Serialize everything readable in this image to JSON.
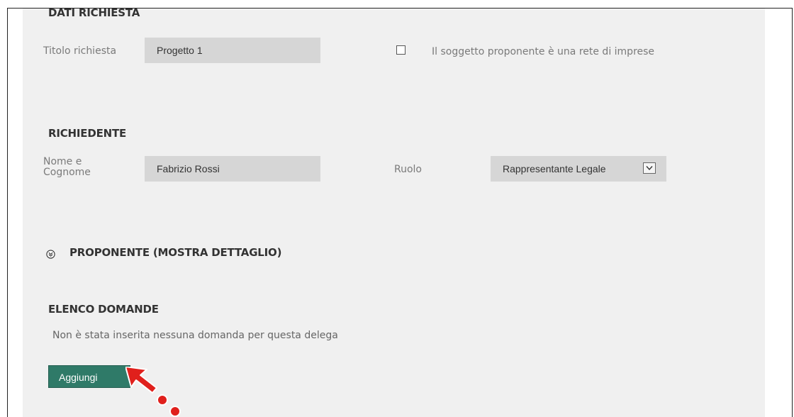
{
  "dati_richiesta": {
    "title": "DATI RICHIESTA",
    "titolo_label": "Titolo richiesta",
    "titolo_value": "Progetto 1",
    "rete_label": "Il soggetto proponente è una rete di imprese"
  },
  "richiedente": {
    "title": "RICHIEDENTE",
    "nome_label_line1": "Nome e",
    "nome_label_line2": "Cognome",
    "nome_value": "Fabrizio Rossi",
    "ruolo_label": "Ruolo",
    "ruolo_value": "Rappresentante Legale"
  },
  "proponente": {
    "title": "PROPONENTE (MOSTRA DETTAGLIO)",
    "icon": "chevron-double-down-icon"
  },
  "elenco_domande": {
    "title": "ELENCO DOMANDE",
    "empty_message": "Non è stata inserita nessuna domanda per questa delega",
    "add_button_label": "Aggiungi"
  },
  "colors": {
    "panel_bg": "#f0f0f0",
    "field_bg": "#d6d6d6",
    "button_bg": "#2f7a68",
    "annotation_arrow": "#e0201c"
  },
  "annotation": {
    "icon": "red-arrow-icon"
  }
}
